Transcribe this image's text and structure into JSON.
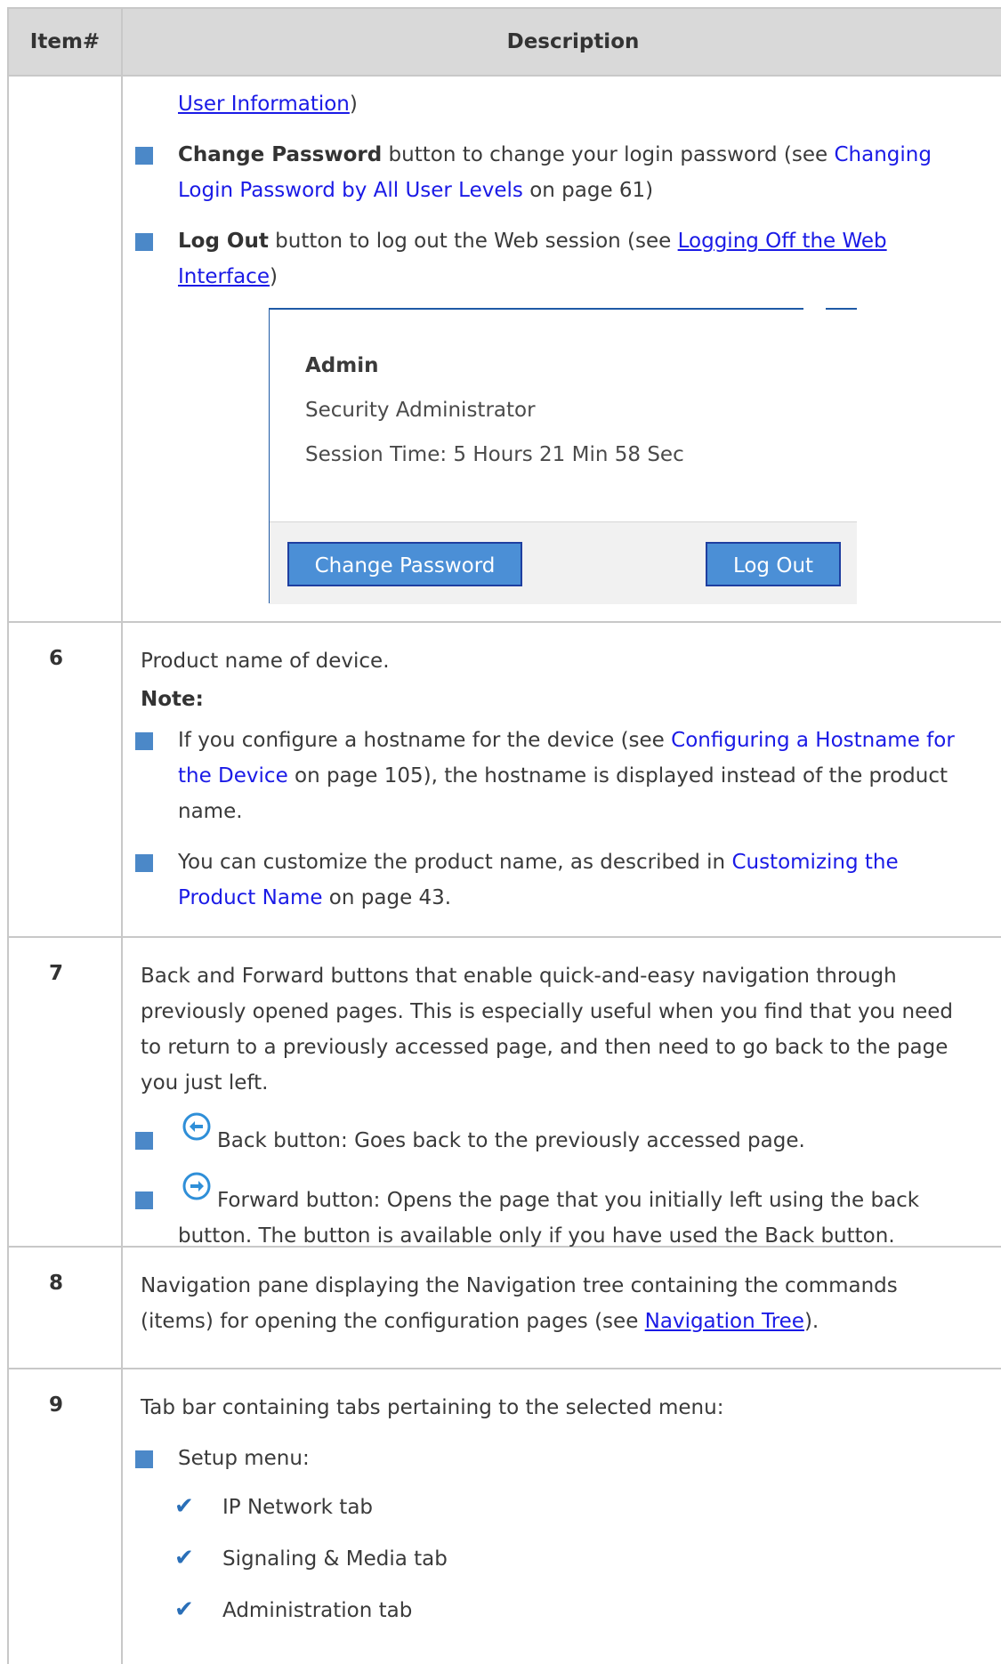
{
  "header": {
    "item_col": "Item#",
    "desc_col": "Description"
  },
  "row5": {
    "cont_link": "User Information",
    "cont_tail": ")",
    "bullet1": {
      "bold": "Change Password",
      "text1": " button to change your login password (see ",
      "link_line1": "Changing",
      "link_line2": "Login Password by All User Levels",
      "text2": " on page 61)"
    },
    "bullet2": {
      "bold": "Log Out",
      "text1": " button to log out the Web session (see ",
      "link_line1": "Logging Off the Web",
      "link_line2": "Interface",
      "text2": ")"
    },
    "screenshot": {
      "user_name": "Admin",
      "user_level": "Security Administrator",
      "session_time": "Session Time: 5 Hours 21 Min 58 Sec",
      "change_password_btn": "Change Password",
      "logout_btn": "Log Out",
      "accent_color": "#4b8fd6"
    }
  },
  "row6": {
    "num": "6",
    "line1": "Product name of device.",
    "note": "Note:",
    "bullet1": {
      "text1": "If you configure a hostname for the device (see ",
      "link_line1": "Configuring a Hostname for",
      "link_line2": "the Device",
      "text2": " on page 105), the hostname is displayed instead of the product",
      "text3": "name."
    },
    "bullet2": {
      "text1": "You can customize the product name, as described in ",
      "link_line1": "Customizing the",
      "link_line2": "Product Name",
      "text2": " on page 43."
    }
  },
  "row7": {
    "num": "7",
    "p1": "Back and Forward buttons that enable quick-and-easy navigation through",
    "p2": "previously opened pages. This is especially useful when you find that you need",
    "p3": "to return to a previously accessed page, and then need to go back to the page",
    "p4": "you just left.",
    "back": "Back button: Goes back to the previously accessed page.",
    "forward1": "Forward button: Opens the page that you initially left using the back",
    "forward2": "button. The button is available only if you have used the Back button.",
    "back_icon": "arrow-left-circle-icon",
    "forward_icon": "arrow-right-circle-icon"
  },
  "row8": {
    "num": "8",
    "line1": "Navigation pane displaying the Navigation tree containing the commands",
    "line2_a": "(items) for opening the configuration pages (see ",
    "line2_link": "Navigation Tree",
    "line2_b": ")."
  },
  "row9": {
    "num": "9",
    "line1": "Tab bar containing tabs pertaining to the selected menu:",
    "bullet": "Setup menu:",
    "checks": [
      "IP Network tab",
      "Signaling & Media tab",
      "Administration tab"
    ]
  },
  "colors": {
    "bullet": "#4b88c8",
    "link": "#1a1ae6",
    "header_bg": "#d9d9d9",
    "border": "#c8c8c8"
  }
}
